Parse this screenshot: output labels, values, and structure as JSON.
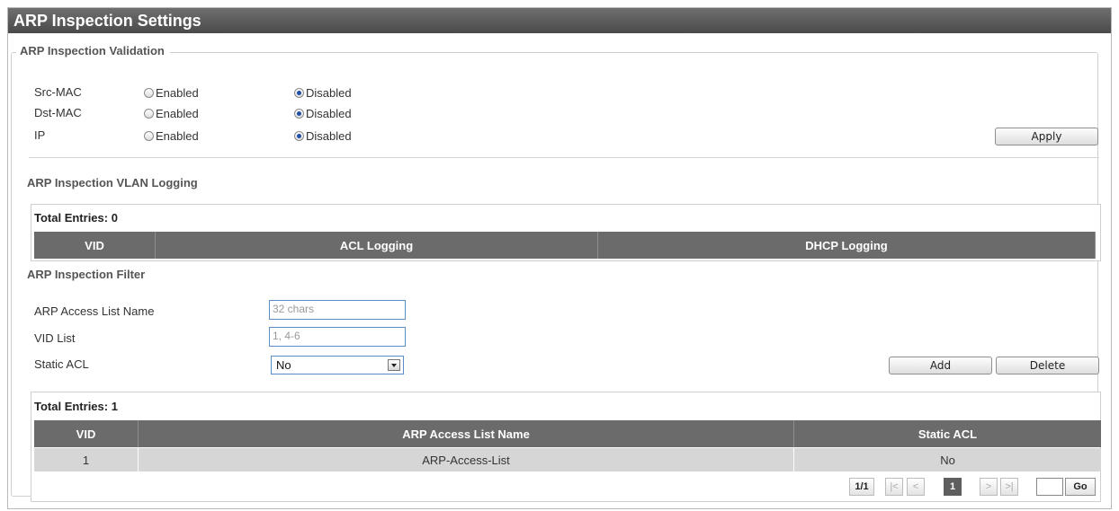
{
  "title": "ARP Inspection Settings",
  "validation": {
    "legend": "ARP Inspection Validation",
    "rows": [
      {
        "label": "Src-MAC",
        "enabled": "Enabled",
        "disabled": "Disabled",
        "selected": "disabled"
      },
      {
        "label": "Dst-MAC",
        "enabled": "Enabled",
        "disabled": "Disabled",
        "selected": "disabled"
      },
      {
        "label": "IP",
        "enabled": "Enabled",
        "disabled": "Disabled",
        "selected": "disabled"
      }
    ],
    "apply_label": "Apply"
  },
  "vlan_logging": {
    "heading": "ARP Inspection VLAN Logging",
    "total": "Total Entries: 0",
    "columns": [
      "VID",
      "ACL Logging",
      "DHCP Logging"
    ]
  },
  "filter": {
    "heading": "ARP Inspection Filter",
    "name_label": "ARP Access List Name",
    "name_placeholder": "32 chars",
    "vid_label": "VID List",
    "vid_placeholder": "1, 4-6",
    "static_label": "Static ACL",
    "static_value": "No",
    "add_label": "Add",
    "delete_label": "Delete"
  },
  "acl_table": {
    "total": "Total Entries: 1",
    "columns": [
      "VID",
      "ARP Access List Name",
      "Static ACL"
    ],
    "rows": [
      {
        "vid": "1",
        "name": "ARP-Access-List",
        "static": "No"
      }
    ]
  },
  "pagination": {
    "info": "1/1",
    "first": "|<",
    "prev": "<",
    "current": "1",
    "next": ">",
    "last": ">|",
    "go_label": "Go"
  }
}
